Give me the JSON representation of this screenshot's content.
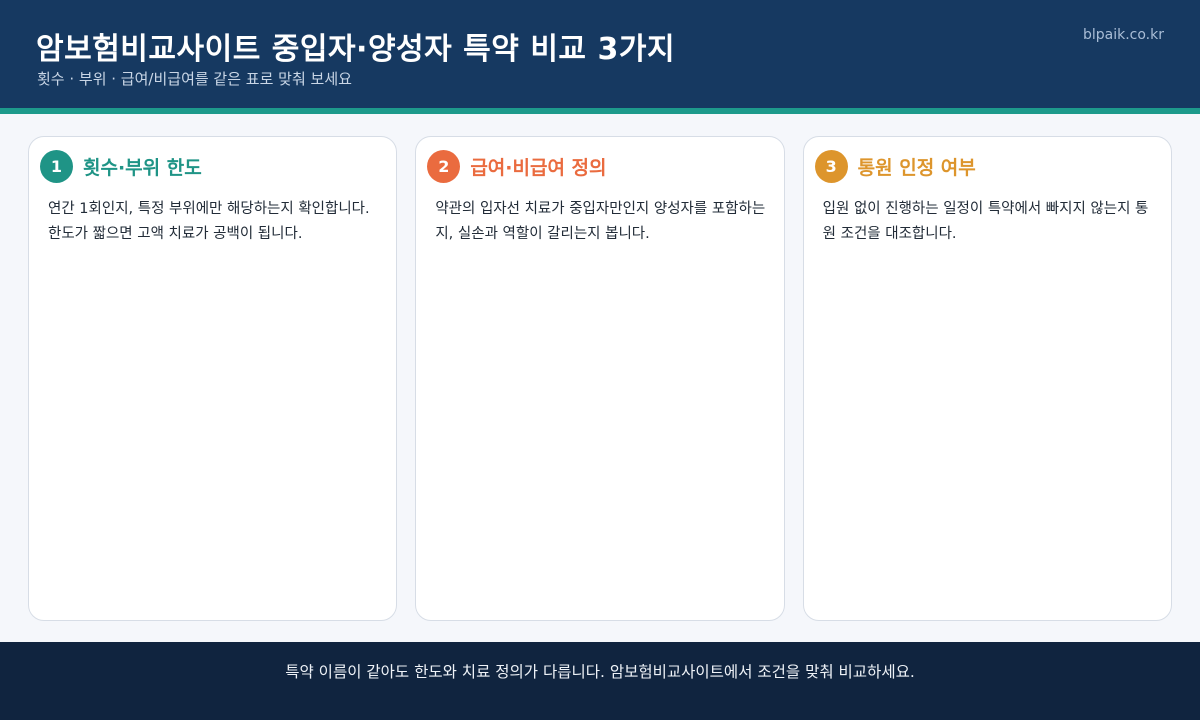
{
  "header": {
    "title": "암보험비교사이트 중입자·양성자 특약 비교 3가지",
    "subtitle": "횟수 · 부위 · 급여/비급여를 같은 표로 맞춰 보세요",
    "site": "blpaik.co.kr"
  },
  "cards": [
    {
      "number": "1",
      "title": "횟수·부위 한도",
      "body": "연간 1회인지, 특정 부위에만 해당하는지 확인합니다. 한도가 짧으면 고액 치료가 공백이 됩니다.",
      "color": "#1f9486"
    },
    {
      "number": "2",
      "title": "급여·비급여 정의",
      "body": "약관의 입자선 치료가 중입자만인지 양성자를 포함하는지, 실손과 역할이 갈리는지 봅니다.",
      "color": "#ea6b3f"
    },
    {
      "number": "3",
      "title": "통원 인정 여부",
      "body": "입원 없이 진행하는 일정이 특약에서 빠지지 않는지 통원 조건을 대조합니다.",
      "color": "#dd952c"
    }
  ],
  "footer": {
    "text": "특약 이름이 같아도 한도와 치료 정의가 다릅니다. 암보험비교사이트에서 조건을 맞춰 비교하세요."
  },
  "colors": {
    "header_bg": "#163961",
    "accent": "#1d9a8b",
    "footer_bg": "#10243f",
    "page_bg": "#f5f7fb"
  }
}
